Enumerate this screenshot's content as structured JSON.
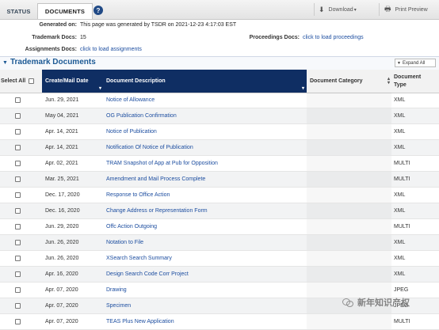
{
  "tabs": {
    "status": "STATUS",
    "documents": "DOCUMENTS",
    "help": "?"
  },
  "toolbar": {
    "download": "Download",
    "print": "Print Preview"
  },
  "info": {
    "generated_label": "Generated on:",
    "generated_value": "This page was generated by TSDR on 2021-12-23 4:17:03 EST",
    "tm_docs_label": "Trademark Docs:",
    "tm_docs_value": "15",
    "proceedings_label": "Proceedings Docs:",
    "proceedings_value": "click to load proceedings",
    "assignments_label": "Assignments Docs:",
    "assignments_value": "click to load assignments"
  },
  "section": {
    "title": "Trademark Documents",
    "expand": "Expand All"
  },
  "columns": {
    "select_all": "Select All",
    "date": "Create/Mail Date",
    "description": "Document Description",
    "category": "Document Category",
    "type": "Document Type"
  },
  "rows": [
    {
      "date": "Jun. 29, 2021",
      "desc": "Notice of Allowance",
      "type": "XML"
    },
    {
      "date": "May 04, 2021",
      "desc": "OG Publication Confirmation",
      "type": "XML"
    },
    {
      "date": "Apr. 14, 2021",
      "desc": "Notice of Publication",
      "type": "XML"
    },
    {
      "date": "Apr. 14, 2021",
      "desc": "Notification Of Notice of Publication",
      "type": "XML"
    },
    {
      "date": "Apr. 02, 2021",
      "desc": "TRAM Snapshot of App at Pub for Opposition",
      "type": "MULTI"
    },
    {
      "date": "Mar. 25, 2021",
      "desc": "Amendment and Mail Process Complete",
      "type": "MULTI"
    },
    {
      "date": "Dec. 17, 2020",
      "desc": "Response to Office Action",
      "type": "XML"
    },
    {
      "date": "Dec. 16, 2020",
      "desc": "Change Address or Representation Form",
      "type": "XML"
    },
    {
      "date": "Jun. 29, 2020",
      "desc": "Offc Action Outgoing",
      "type": "MULTI"
    },
    {
      "date": "Jun. 26, 2020",
      "desc": "Notation to File",
      "type": "XML"
    },
    {
      "date": "Jun. 26, 2020",
      "desc": "XSearch Search Summary",
      "type": "XML"
    },
    {
      "date": "Apr. 16, 2020",
      "desc": "Design Search Code Corr Project",
      "type": "XML"
    },
    {
      "date": "Apr. 07, 2020",
      "desc": "Drawing",
      "type": "JPEG"
    },
    {
      "date": "Apr. 07, 2020",
      "desc": "Specimen",
      "type": "JPEG"
    },
    {
      "date": "Apr. 07, 2020",
      "desc": "TEAS Plus New Application",
      "type": "MULTI"
    }
  ],
  "watermark": "新年知识产权",
  "colors": {
    "header_dark": "#0f2e63",
    "link": "#1d4ea0",
    "section_title": "#1d5a95"
  }
}
